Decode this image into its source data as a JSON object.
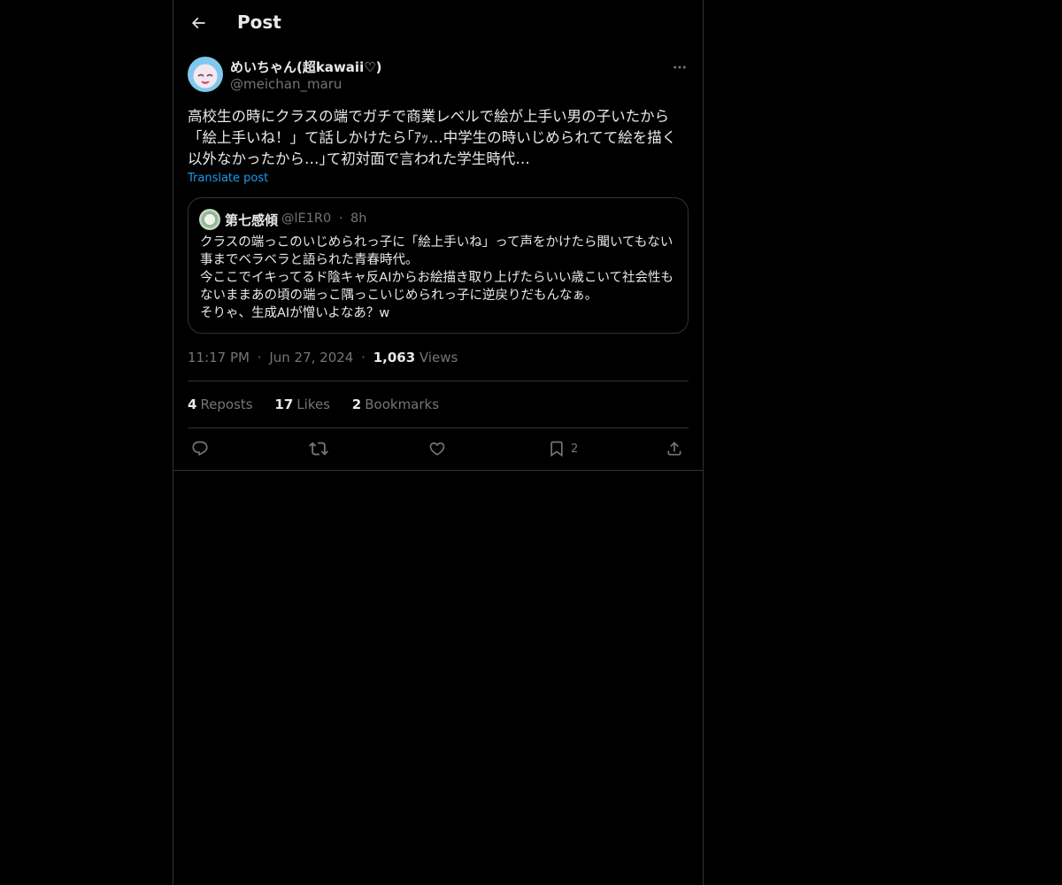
{
  "header": {
    "title": "Post"
  },
  "post": {
    "author_name": "めいちゃん(超kawaii♡)",
    "author_handle": "@meichan_maru",
    "text": "高校生の時にクラスの端でガチで商業レベルで絵が上手い男の子いたから「絵上手いね！」て話しかけたら｢ｱｯ…中学生の時いじめられてて絵を描く以外なかったから…｣て初対面で言われた学生時代…",
    "translate_label": "Translate post",
    "quote": {
      "author_name": "第七感傾",
      "author_handle": "@lE1R0",
      "time": "8h",
      "text": "クラスの端っこのいじめられっ子に「絵上手いね」って声をかけたら聞いてもない事までベラベラと語られた青春時代。\n今ここでイキってるド陰キャ反AIからお絵描き取り上げたらいい歳こいて社会性もないままあの頃の端っこ隅っこいじめられっ子に逆戻りだもんなぁ。\nそりゃ、生成AIが憎いよなあ？w"
    },
    "time": "11:17 PM",
    "date": "Jun 27, 2024",
    "views_count": "1,063",
    "views_label": "Views",
    "separator": "·"
  },
  "stats": {
    "reposts_count": "4",
    "reposts_label": "Reposts",
    "likes_count": "17",
    "likes_label": "Likes",
    "bookmarks_count": "2",
    "bookmarks_label": "Bookmarks"
  },
  "actions": {
    "bookmark_count": "2"
  },
  "colors": {
    "background": "#000000",
    "border": "#2f3336",
    "text": "#e7e9ea",
    "secondary": "#71767b",
    "link": "#1d9bf0"
  },
  "icons": [
    "back-arrow-icon",
    "more-icon",
    "reply-icon",
    "repost-icon",
    "like-icon",
    "bookmark-icon",
    "share-icon"
  ]
}
